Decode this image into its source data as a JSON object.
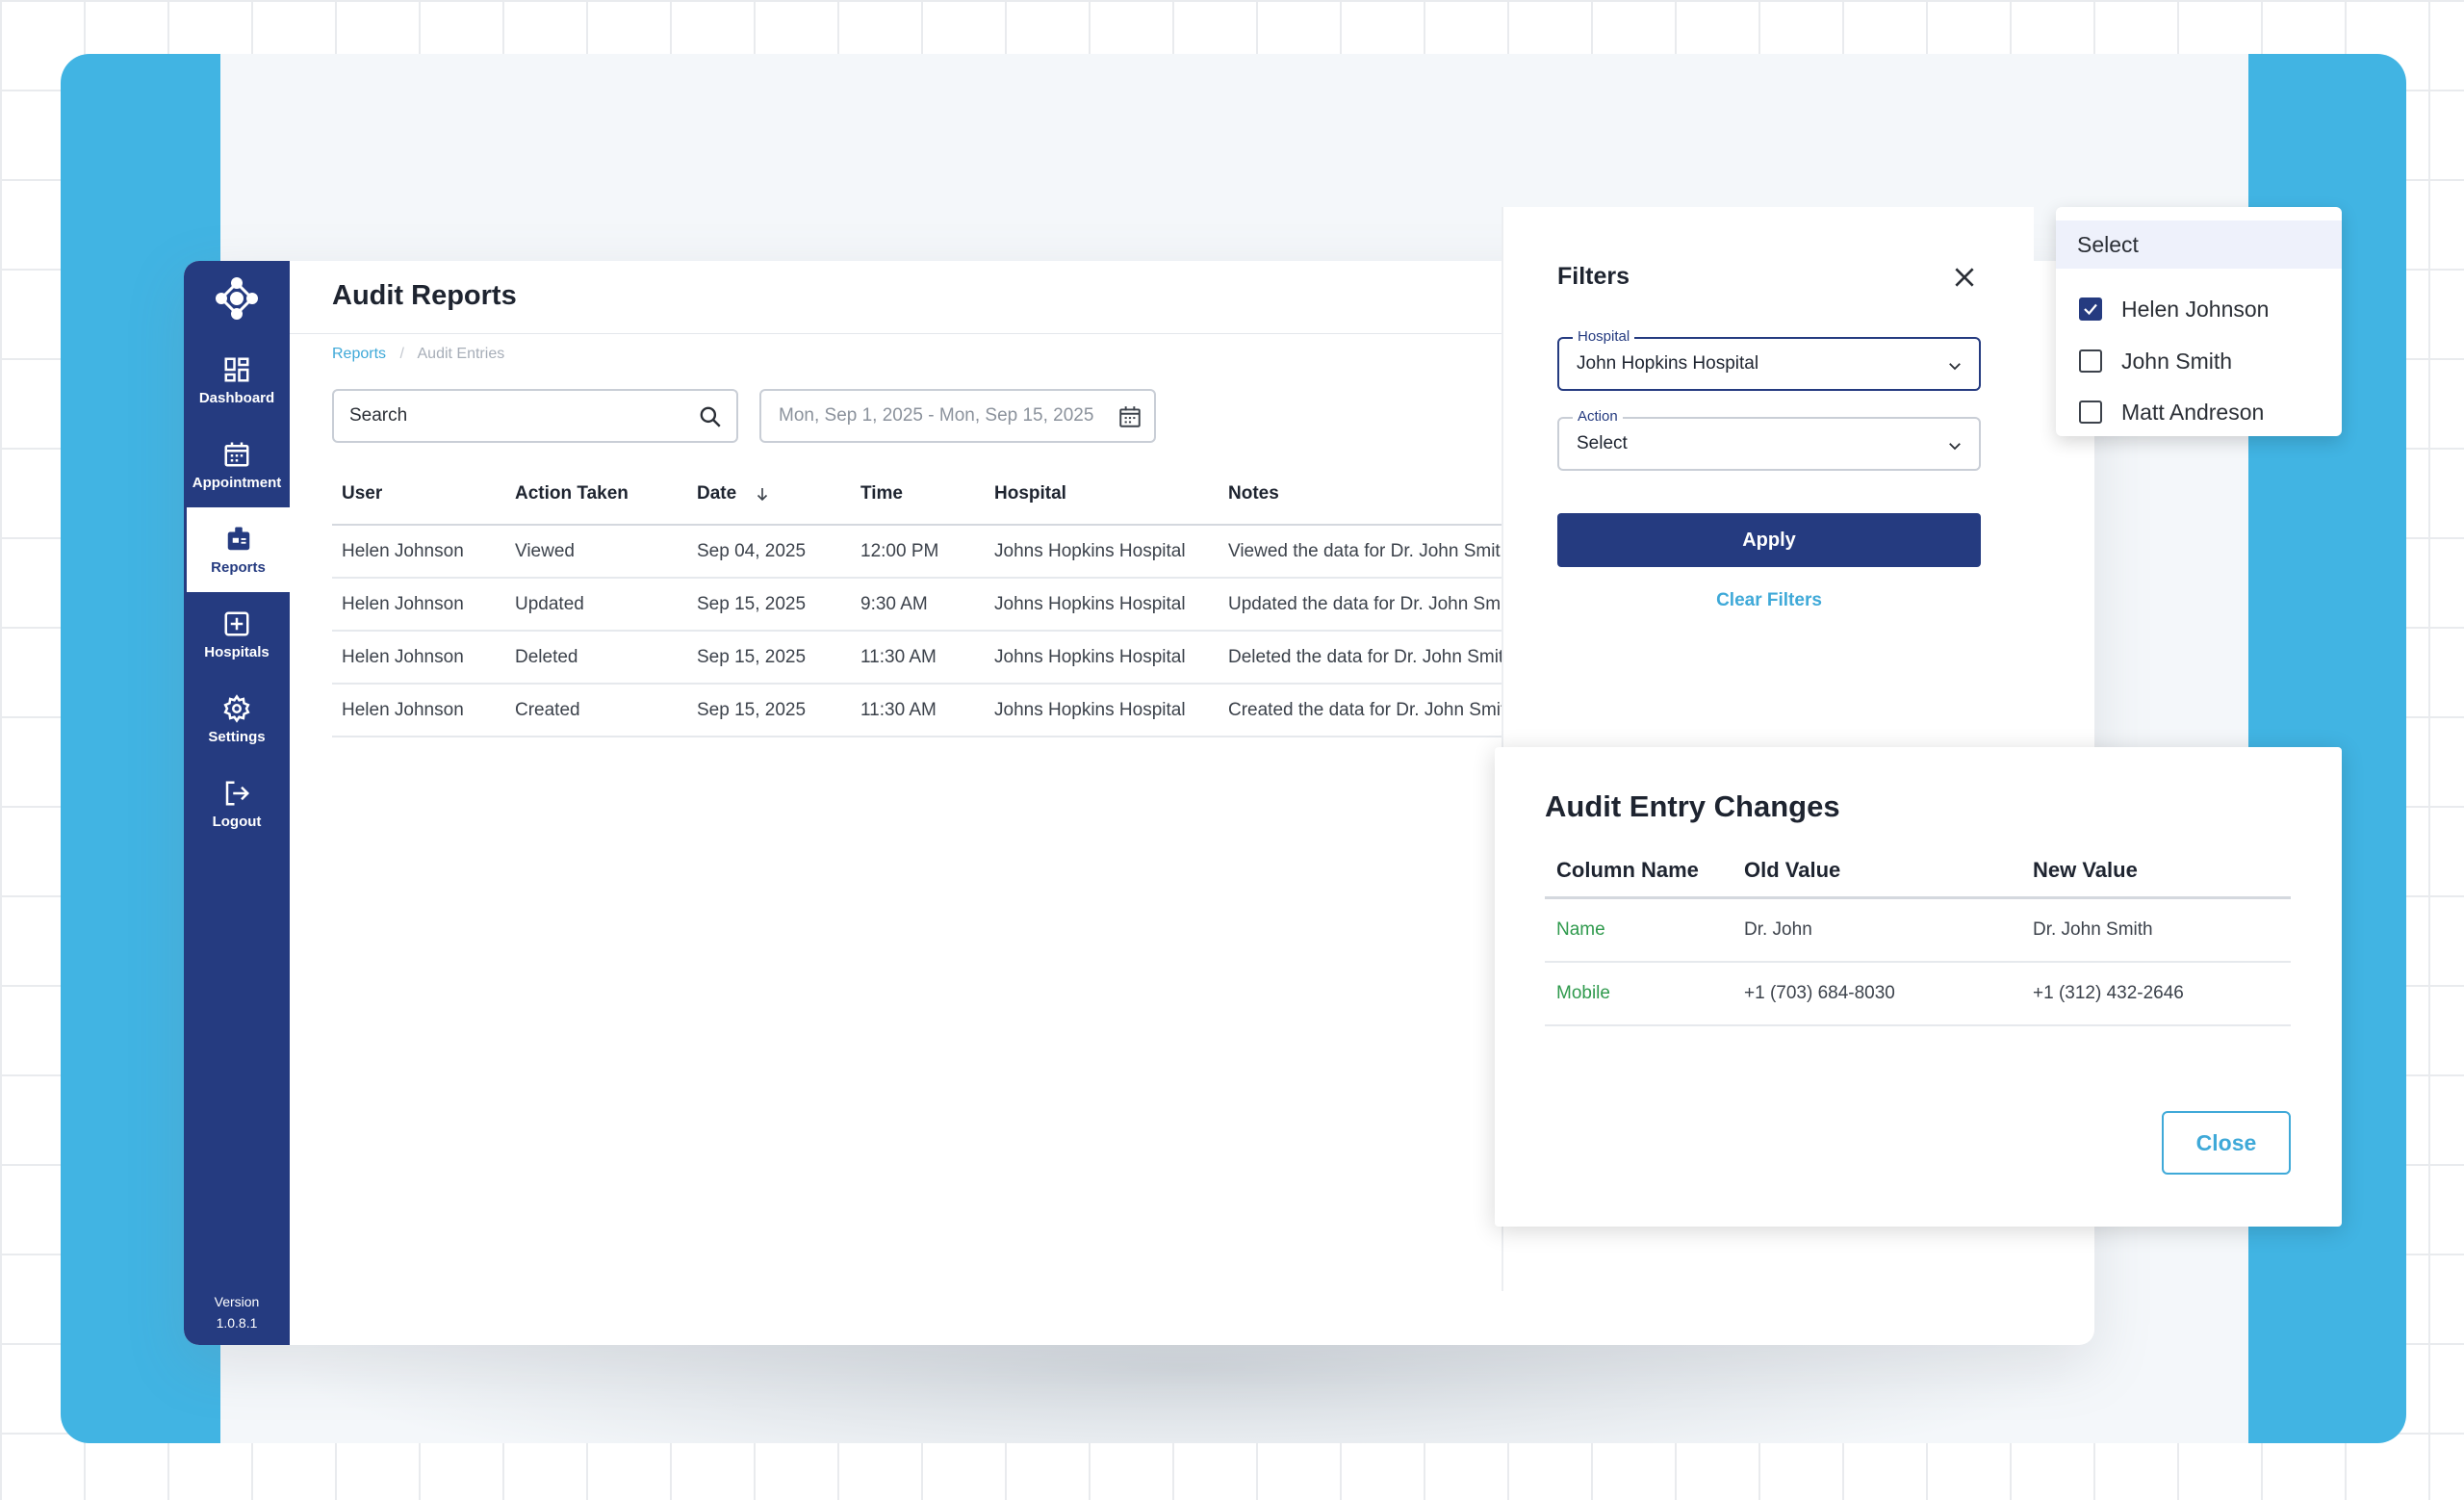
{
  "app": {
    "title": "Audit Reports",
    "version_label": "Version",
    "version_number": "1.0.8.1"
  },
  "nav": {
    "items": [
      {
        "label": "Dashboard",
        "icon": "dashboard-icon"
      },
      {
        "label": "Appointment",
        "icon": "calendar-icon"
      },
      {
        "label": "Reports",
        "icon": "reports-icon",
        "active": true
      },
      {
        "label": "Hospitals",
        "icon": "hospital-plus-icon"
      },
      {
        "label": "Settings",
        "icon": "gear-icon"
      },
      {
        "label": "Logout",
        "icon": "logout-icon"
      }
    ]
  },
  "breadcrumb": {
    "parent": "Reports",
    "current": "Audit Entries"
  },
  "search": {
    "placeholder": "Search"
  },
  "date_range": {
    "value": "Mon, Sep 1, 2025 - Mon, Sep 15, 2025"
  },
  "table": {
    "columns": [
      "User",
      "Action Taken",
      "Date",
      "Time",
      "Hospital",
      "Notes"
    ],
    "rows": [
      [
        "Helen Johnson",
        "Viewed",
        "Sep 04, 2025",
        "12:00 PM",
        "Johns Hopkins Hospital",
        "Viewed the data for Dr. John Smith"
      ],
      [
        "Helen Johnson",
        "Updated",
        "Sep 15, 2025",
        "9:30 AM",
        "Johns Hopkins Hospital",
        "Updated the data for Dr. John Smith"
      ],
      [
        "Helen Johnson",
        "Deleted",
        "Sep 15, 2025",
        "11:30 AM",
        "Johns Hopkins Hospital",
        "Deleted the data for Dr. John Smith"
      ],
      [
        "Helen Johnson",
        "Created",
        "Sep 15, 2025",
        "11:30 AM",
        "Johns Hopkins Hospital",
        "Created the data for Dr. John Smith"
      ]
    ]
  },
  "filters": {
    "title": "Filters",
    "hospital_label": "Hospital",
    "hospital_value": "John Hopkins Hospital",
    "action_label": "Action",
    "action_value": "Select",
    "apply_label": "Apply",
    "clear_label": "Clear Filters"
  },
  "user_dropdown": {
    "header": "Select",
    "options": [
      {
        "label": "Helen Johnson",
        "checked": true
      },
      {
        "label": "John Smith",
        "checked": false
      },
      {
        "label": "Matt Andreson",
        "checked": false
      }
    ]
  },
  "changes": {
    "title": "Audit Entry Changes",
    "columns": [
      "Column Name",
      "Old Value",
      "New Value"
    ],
    "rows": [
      [
        "Name",
        "Dr. John",
        "Dr. John Smith"
      ],
      [
        "Mobile",
        "+1 (703) 684-8030",
        "+1 (312) 432-2646"
      ]
    ],
    "close_label": "Close"
  },
  "colors": {
    "brand": "#253b80",
    "accent": "#41b4e3",
    "link": "#3fa9d8",
    "green": "#2f9a4d"
  }
}
